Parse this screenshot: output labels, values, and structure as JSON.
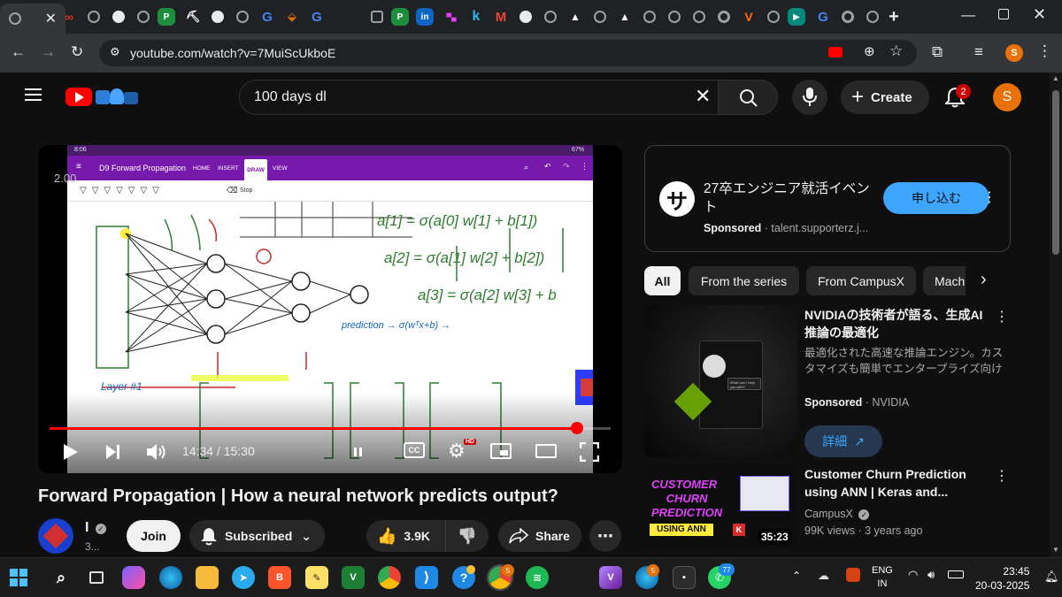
{
  "browser": {
    "active_tab_close": "✕",
    "new_tab": "+",
    "url": "youtube.com/watch?v=7MuiScUkboE",
    "profile_initial": "S"
  },
  "youtube": {
    "search_query": "100 days dl",
    "create_label": "Create",
    "notification_count": "2",
    "avatar_initial": "S"
  },
  "player": {
    "slide": {
      "status_time": "8:06",
      "battery": "67%",
      "notebook_title": "D9 Forward Propagation",
      "tabs": [
        "HOME",
        "INSERT",
        "DRAW",
        "VIEW"
      ],
      "stop_label": "Stop",
      "layer_label": "Layer #1",
      "formula_a1": "a[1] = σ(a[0] w[1] + b[1])",
      "formula_a2": "a[2] = σ(a[1] w[2] + b[2])",
      "formula_a3": "a[3] = σ(a[2] w[3] + b",
      "prediction_label": "prediction → σ(wᵀx+b) →"
    },
    "playback_speed": "2.00",
    "current_time": "14:34",
    "duration": "15:30",
    "progress_fraction": 0.94
  },
  "video": {
    "title": "Forward Propagation | How a neural network predicts output?",
    "channel_name": "I",
    "subscribers": "3...",
    "join_label": "Join",
    "subscribed_label": "Subscribed",
    "likes": "3.9K",
    "share_label": "Share"
  },
  "sidebar": {
    "ad": {
      "title": "27卒エンジニア就活イベント",
      "sponsored": "Sponsored",
      "domain": "talent.supporterz.j...",
      "cta": "申し込む",
      "logo_glyph": "サ"
    },
    "chips": [
      "All",
      "From the series",
      "From CampusX",
      "Mach"
    ],
    "recommendations": [
      {
        "title": "NVIDIAの技術者が語る、生成AI推論の最適化",
        "description": "最適化された高速な推論エンジン。カスタマイズも簡単でエンタープライズ向け",
        "sponsored": "Sponsored",
        "advertiser": "NVIDIA",
        "cta": "詳細",
        "thumb_caption": "What can I help you with?"
      },
      {
        "title": "Customer Churn Prediction using ANN | Keras and...",
        "channel": "CampusX",
        "views": "99K views",
        "age": "3 years ago",
        "duration": "35:23",
        "thumb_line1": "CUSTOMER",
        "thumb_line2": "CHURN",
        "thumb_line3": "PREDICTION",
        "thumb_line4": "USING ANN",
        "thumb_badge": "K"
      }
    ]
  },
  "taskbar": {
    "language": "ENG",
    "region": "IN",
    "time": "23:45",
    "date": "20-03-2025",
    "whatsapp_badge": "77",
    "chrome_badge": "5",
    "edge_badge": "5"
  },
  "colors": {
    "yt_red": "#ff0000",
    "onenote_purple": "#7719aa",
    "apply_blue": "#3ea6ff",
    "avatar_orange": "#e8710a"
  }
}
